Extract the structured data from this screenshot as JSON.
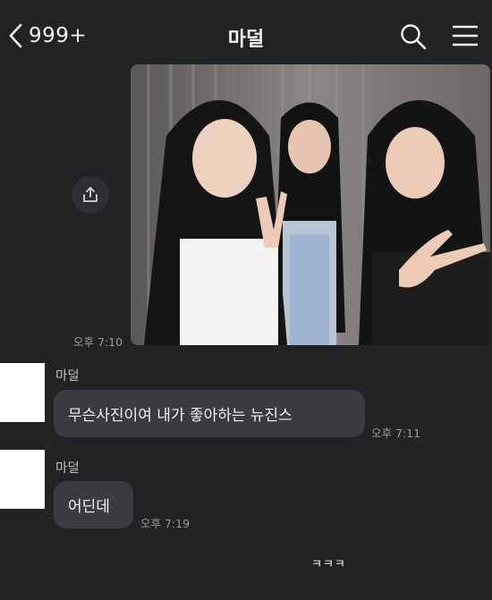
{
  "header": {
    "back_count": "999+",
    "title": "마덜"
  },
  "icons": [
    "chevron-left-icon",
    "search-icon",
    "hamburger-menu-icon",
    "share-icon"
  ],
  "messages": {
    "photo_time": "오후 7:10",
    "incoming": [
      {
        "sender": "마덜",
        "text": "무슨사진이여 내가 좋아하는 뉴진스",
        "time": "오후 7:11"
      },
      {
        "sender": "마덜",
        "text": "어딘데",
        "time": "오후 7:19"
      }
    ]
  },
  "bottom_text": "ㅋㅋㅋ",
  "colors": {
    "background": "#222325",
    "bubble": "#3b3c40",
    "timestamp": "#9a9a9a"
  }
}
